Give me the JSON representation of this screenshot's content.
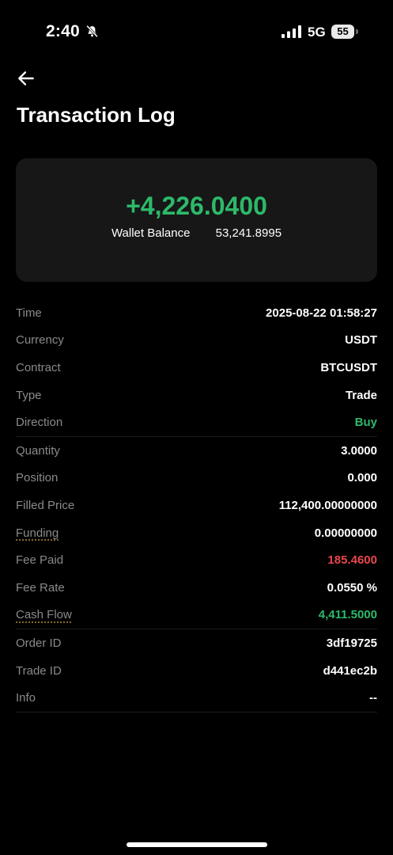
{
  "status_bar": {
    "time": "2:40",
    "network": "5G",
    "battery": "55"
  },
  "header": {
    "title": "Transaction Log"
  },
  "summary": {
    "amount": "+4,226.0400",
    "wallet_label": "Wallet Balance",
    "wallet_value": "53,241.8995"
  },
  "details": [
    {
      "label": "Time",
      "value": "2025-08-22 01:58:27"
    },
    {
      "label": "Currency",
      "value": "USDT"
    },
    {
      "label": "Contract",
      "value": "BTCUSDT"
    },
    {
      "label": "Type",
      "value": "Trade"
    },
    {
      "label": "Direction",
      "value": "Buy"
    },
    {
      "label": "Quantity",
      "value": "3.0000"
    },
    {
      "label": "Position",
      "value": "0.000"
    },
    {
      "label": "Filled Price",
      "value": "112,400.00000000"
    },
    {
      "label": "Funding",
      "value": "0.00000000"
    },
    {
      "label": "Fee Paid",
      "value": "185.4600"
    },
    {
      "label": "Fee Rate",
      "value": "0.0550 %"
    },
    {
      "label": "Cash Flow",
      "value": "4,411.5000"
    },
    {
      "label": "Order ID",
      "value": "3df19725"
    },
    {
      "label": "Trade ID",
      "value": "d441ec2b"
    },
    {
      "label": "Info",
      "value": "--"
    }
  ],
  "colors": {
    "positive": "#2db96a",
    "negative": "#e8474d",
    "card_bg": "#171717"
  },
  "icons": [
    "bell-slash-icon",
    "signal-icon",
    "battery-icon",
    "back-arrow-icon"
  ]
}
